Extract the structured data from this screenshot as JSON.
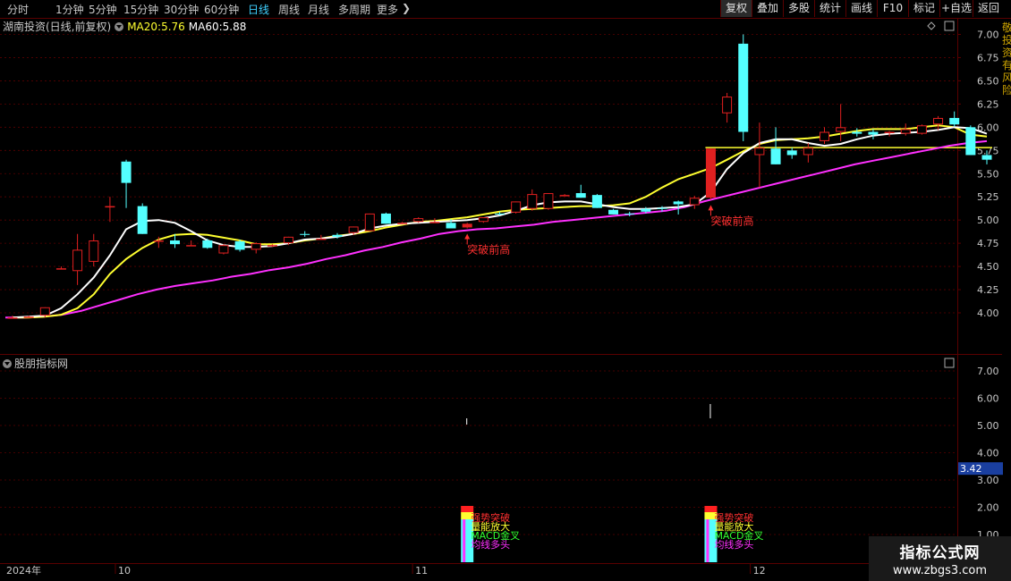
{
  "toolbar": {
    "periods": [
      "分时",
      "1分钟",
      "5分钟",
      "15分钟",
      "30分钟",
      "60分钟",
      "日线",
      "周线",
      "月线",
      "多周期",
      "更多"
    ],
    "active_period": "日线",
    "buttons": [
      "复权",
      "叠加",
      "多股",
      "统计",
      "画线",
      "F10",
      "标记",
      "+自选",
      "返回"
    ],
    "active_button": "复权"
  },
  "info": {
    "stock": "湖南投资(日线,前复权)",
    "ma20_label": "MA20:",
    "ma20_value": "5.76",
    "ma60_label": "MA60:",
    "ma60_value": "5.88"
  },
  "sub": {
    "title": "股朋指标网"
  },
  "watermark": {
    "line1": "指标公式网",
    "line2": "www.zbgs3.com"
  },
  "right_strip_text": "敬投资有风险",
  "colors": {
    "bg": "#000000",
    "grid": "#5a0000",
    "up": "#e02020",
    "down": "#54ffff",
    "ma_white": "#ffffff",
    "ma_yellow": "#ffff30",
    "ma_magenta": "#ff30ff",
    "axis_text": "#c8c8c8"
  },
  "chart_data": [
    {
      "type": "candlestick",
      "title": "湖南投资(日线,前复权)",
      "yticks": [
        "7.00",
        "6.75",
        "6.50",
        "6.25",
        "6.00",
        "5.75",
        "5.50",
        "5.25",
        "5.00",
        "4.75",
        "4.50",
        "4.25",
        "4.00"
      ],
      "ylim": [
        3.95,
        7.05
      ],
      "date_labels": [
        "2024年",
        "10",
        "11",
        "12"
      ],
      "candles": [
        {
          "o": 3.95,
          "h": 3.97,
          "l": 3.94,
          "c": 3.95
        },
        {
          "o": 3.96,
          "h": 3.97,
          "l": 3.95,
          "c": 3.96
        },
        {
          "o": 3.97,
          "h": 4.06,
          "l": 3.95,
          "c": 4.06
        },
        {
          "o": 4.48,
          "h": 4.5,
          "l": 4.47,
          "c": 4.48
        },
        {
          "o": 4.45,
          "h": 4.85,
          "l": 4.3,
          "c": 4.68
        },
        {
          "o": 4.55,
          "h": 4.85,
          "l": 4.5,
          "c": 4.78
        },
        {
          "o": 5.15,
          "h": 5.25,
          "l": 4.98,
          "c": 5.15
        },
        {
          "o": 5.63,
          "h": 5.65,
          "l": 5.13,
          "c": 5.4
        },
        {
          "o": 5.15,
          "h": 5.18,
          "l": 4.85,
          "c": 4.85
        },
        {
          "o": 4.78,
          "h": 4.82,
          "l": 4.7,
          "c": 4.78
        },
        {
          "o": 4.78,
          "h": 4.85,
          "l": 4.7,
          "c": 4.74
        },
        {
          "o": 4.73,
          "h": 4.78,
          "l": 4.72,
          "c": 4.73
        },
        {
          "o": 4.78,
          "h": 4.8,
          "l": 4.69,
          "c": 4.7
        },
        {
          "o": 4.64,
          "h": 4.74,
          "l": 4.63,
          "c": 4.73
        },
        {
          "o": 4.77,
          "h": 4.79,
          "l": 4.66,
          "c": 4.68
        },
        {
          "o": 4.68,
          "h": 4.76,
          "l": 4.64,
          "c": 4.75
        },
        {
          "o": 4.72,
          "h": 4.74,
          "l": 4.71,
          "c": 4.73
        },
        {
          "o": 4.75,
          "h": 4.82,
          "l": 4.73,
          "c": 4.82
        },
        {
          "o": 4.85,
          "h": 4.88,
          "l": 4.82,
          "c": 4.84
        },
        {
          "o": 4.8,
          "h": 4.84,
          "l": 4.79,
          "c": 4.8
        },
        {
          "o": 4.84,
          "h": 4.86,
          "l": 4.8,
          "c": 4.82
        },
        {
          "o": 4.86,
          "h": 4.93,
          "l": 4.84,
          "c": 4.93
        },
        {
          "o": 4.88,
          "h": 5.07,
          "l": 4.88,
          "c": 5.07
        },
        {
          "o": 5.07,
          "h": 5.08,
          "l": 4.96,
          "c": 4.96
        },
        {
          "o": 4.97,
          "h": 4.98,
          "l": 4.96,
          "c": 4.97
        },
        {
          "o": 4.98,
          "h": 5.03,
          "l": 4.97,
          "c": 5.02
        },
        {
          "o": 4.98,
          "h": 5.02,
          "l": 4.97,
          "c": 4.98
        },
        {
          "o": 4.97,
          "h": 5.01,
          "l": 4.91,
          "c": 4.91
        },
        {
          "o": 4.92,
          "h": 4.97,
          "l": 4.91,
          "c": 4.96
        },
        {
          "o": 4.98,
          "h": 5.03,
          "l": 4.97,
          "c": 5.03
        },
        {
          "o": 5.07,
          "h": 5.09,
          "l": 5.05,
          "c": 5.06
        },
        {
          "o": 5.08,
          "h": 5.2,
          "l": 5.07,
          "c": 5.2
        },
        {
          "o": 5.12,
          "h": 5.33,
          "l": 5.1,
          "c": 5.28
        },
        {
          "o": 5.12,
          "h": 5.29,
          "l": 5.11,
          "c": 5.29
        },
        {
          "o": 5.27,
          "h": 5.28,
          "l": 5.26,
          "c": 5.27
        },
        {
          "o": 5.29,
          "h": 5.38,
          "l": 5.24,
          "c": 5.24
        },
        {
          "o": 5.27,
          "h": 5.28,
          "l": 5.13,
          "c": 5.13
        },
        {
          "o": 5.11,
          "h": 5.12,
          "l": 5.06,
          "c": 5.06
        },
        {
          "o": 5.07,
          "h": 5.09,
          "l": 5.04,
          "c": 5.06
        },
        {
          "o": 5.12,
          "h": 5.14,
          "l": 5.07,
          "c": 5.09
        },
        {
          "o": 5.13,
          "h": 5.15,
          "l": 5.09,
          "c": 5.12
        },
        {
          "o": 5.2,
          "h": 5.21,
          "l": 5.06,
          "c": 5.17
        },
        {
          "o": 5.16,
          "h": 5.26,
          "l": 5.12,
          "c": 5.24
        },
        {
          "o": 5.24,
          "h": 5.77,
          "l": 5.22,
          "c": 5.77
        },
        {
          "o": 6.15,
          "h": 6.37,
          "l": 6.05,
          "c": 6.33
        },
        {
          "o": 6.9,
          "h": 7.0,
          "l": 5.85,
          "c": 5.95
        },
        {
          "o": 5.7,
          "h": 6.05,
          "l": 5.35,
          "c": 5.78
        },
        {
          "o": 5.77,
          "h": 6.0,
          "l": 5.6,
          "c": 5.6
        },
        {
          "o": 5.75,
          "h": 5.78,
          "l": 5.66,
          "c": 5.7
        },
        {
          "o": 5.7,
          "h": 5.83,
          "l": 5.62,
          "c": 5.78
        },
        {
          "o": 5.85,
          "h": 6.0,
          "l": 5.82,
          "c": 5.95
        },
        {
          "o": 5.95,
          "h": 6.25,
          "l": 5.85,
          "c": 6.0
        },
        {
          "o": 5.95,
          "h": 5.99,
          "l": 5.9,
          "c": 5.93
        },
        {
          "o": 5.95,
          "h": 5.98,
          "l": 5.87,
          "c": 5.92
        },
        {
          "o": 5.94,
          "h": 5.96,
          "l": 5.9,
          "c": 5.95
        },
        {
          "o": 5.93,
          "h": 6.04,
          "l": 5.91,
          "c": 5.98
        },
        {
          "o": 5.93,
          "h": 6.03,
          "l": 5.92,
          "c": 6.02
        },
        {
          "o": 6.03,
          "h": 6.12,
          "l": 5.97,
          "c": 6.1
        },
        {
          "o": 6.1,
          "h": 6.17,
          "l": 6.01,
          "c": 6.03
        },
        {
          "o": 6.0,
          "h": 6.02,
          "l": 5.7,
          "c": 5.7
        },
        {
          "o": 5.7,
          "h": 5.75,
          "l": 5.6,
          "c": 5.65
        }
      ],
      "ma_white": [
        3.95,
        3.96,
        3.97,
        4.05,
        4.2,
        4.38,
        4.62,
        4.9,
        4.99,
        5.0,
        4.97,
        4.88,
        4.78,
        4.73,
        4.71,
        4.71,
        4.72,
        4.75,
        4.79,
        4.8,
        4.82,
        4.85,
        4.91,
        4.94,
        4.96,
        4.97,
        4.98,
        4.99,
        5.0,
        5.02,
        5.05,
        5.1,
        5.16,
        5.19,
        5.2,
        5.2,
        5.17,
        5.14,
        5.12,
        5.12,
        5.13,
        5.14,
        5.17,
        5.3,
        5.55,
        5.72,
        5.83,
        5.87,
        5.87,
        5.83,
        5.8,
        5.82,
        5.87,
        5.91,
        5.93,
        5.94,
        5.95,
        5.97,
        6.0,
        5.99,
        5.93
      ],
      "ma_yellow": [
        3.95,
        3.95,
        3.96,
        3.98,
        4.05,
        4.2,
        4.42,
        4.58,
        4.7,
        4.79,
        4.84,
        4.85,
        4.84,
        4.81,
        4.78,
        4.74,
        4.74,
        4.75,
        4.78,
        4.8,
        4.83,
        4.85,
        4.88,
        4.92,
        4.95,
        4.98,
        4.99,
        5.01,
        5.03,
        5.06,
        5.09,
        5.11,
        5.12,
        5.13,
        5.14,
        5.15,
        5.15,
        5.16,
        5.18,
        5.25,
        5.35,
        5.44,
        5.5,
        5.56,
        5.65,
        5.74,
        5.82,
        5.86,
        5.87,
        5.88,
        5.9,
        5.93,
        5.96,
        5.98,
        5.98,
        5.98,
        6.0,
        6.02,
        6.0,
        5.92,
        5.9
      ],
      "ma_magenta": [
        3.95,
        3.95,
        3.96,
        3.98,
        4.02,
        4.08,
        4.14,
        4.2,
        4.25,
        4.29,
        4.32,
        4.35,
        4.39,
        4.42,
        4.46,
        4.49,
        4.53,
        4.58,
        4.62,
        4.67,
        4.71,
        4.76,
        4.8,
        4.85,
        4.88,
        4.9,
        4.91,
        4.93,
        4.95,
        4.98,
        5.0,
        5.02,
        5.04,
        5.06,
        5.08,
        5.1,
        5.14,
        5.2,
        5.25,
        5.3,
        5.35,
        5.4,
        5.45,
        5.5,
        5.55,
        5.6,
        5.64,
        5.68,
        5.72,
        5.76,
        5.8,
        5.83,
        5.85
      ],
      "hline": 5.78,
      "annotations": [
        {
          "text": "突破前高",
          "candle": 28
        },
        {
          "text": "突破前高",
          "candle": 43
        }
      ]
    },
    {
      "type": "bar",
      "title": "股朋指标网",
      "yticks": [
        "7.00",
        "6.00",
        "5.00",
        "4.00",
        "3.00",
        "2.00",
        "1.00"
      ],
      "ylim": [
        0.6,
        7.6
      ],
      "current_value": "3.42",
      "signals": [
        {
          "candle": 28,
          "labels": [
            "强势突破",
            "量能放大",
            "MACD金叉",
            "均线多头"
          ]
        },
        {
          "candle": 43,
          "labels": [
            "强势突破",
            "量能放大",
            "MACD金叉",
            "均线多头"
          ]
        }
      ]
    }
  ]
}
